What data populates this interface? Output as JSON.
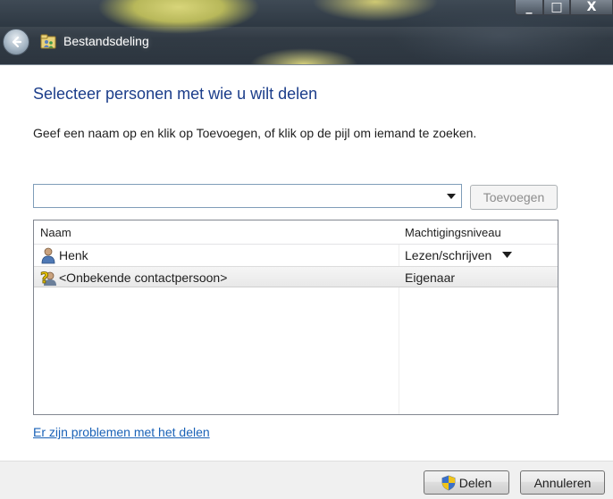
{
  "window": {
    "title": "Bestandsdeling",
    "minimize_glyph": "_",
    "maximize_glyph": "□",
    "close_glyph": "X"
  },
  "header": {
    "heading": "Selecteer personen met wie u wilt delen",
    "instruction": "Geef een naam op en klik op Toevoegen, of klik op de pijl om iemand te zoeken."
  },
  "add_person": {
    "input_value": "",
    "add_button_label": "Toevoegen"
  },
  "people_list": {
    "columns": [
      "Naam",
      "Machtigingsniveau"
    ],
    "rows": [
      {
        "name": "Henk",
        "permission": "Lezen/schrijven",
        "icon": "user-icon"
      },
      {
        "name": "<Onbekende contactpersoon>",
        "permission": "Eigenaar",
        "icon": "unknown-contact-icon"
      }
    ]
  },
  "links": {
    "help": "Er zijn problemen met het delen"
  },
  "footer": {
    "share_button_label": "Delen",
    "cancel_button_label": "Annuleren"
  },
  "colors": {
    "heading": "#1b3d8a",
    "link": "#1a62b7",
    "footer_bg": "#f0f0f0"
  }
}
